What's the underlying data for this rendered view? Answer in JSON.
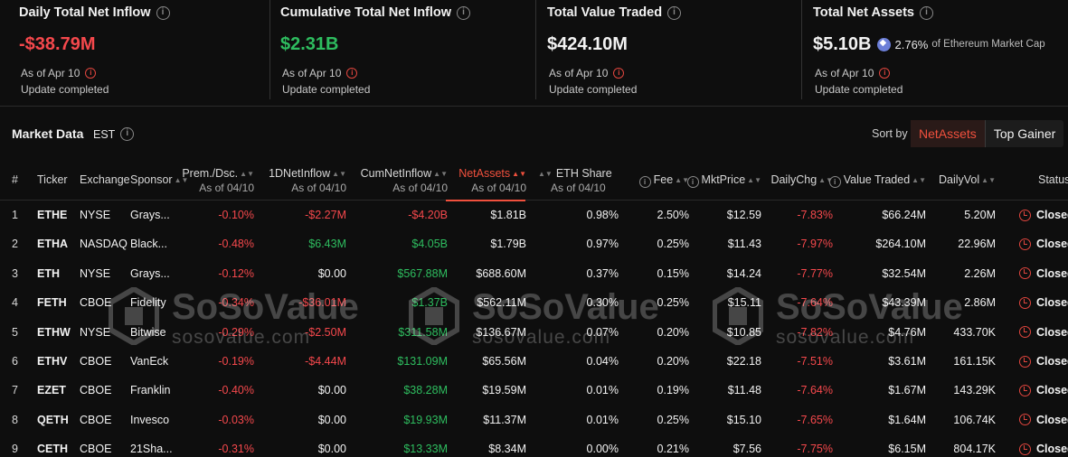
{
  "cards": [
    {
      "title": "Daily Total Net Inflow",
      "value": "-$38.79M",
      "as_of": "As of Apr 10",
      "status": "Update completed",
      "tone": "neg"
    },
    {
      "title": "Cumulative Total Net Inflow",
      "value": "$2.31B",
      "as_of": "As of Apr 10",
      "status": "Update completed",
      "tone": "pos"
    },
    {
      "title": "Total Value Traded",
      "value": "$424.10M",
      "as_of": "As of Apr 10",
      "status": "Update completed",
      "tone": "white"
    },
    {
      "title": "Total Net Assets",
      "value": "$5.10B",
      "eth_pct": "2.76%",
      "eth_suffix": "of Ethereum Market Cap",
      "as_of": "As of Apr 10",
      "status": "Update completed",
      "tone": "white"
    }
  ],
  "market": {
    "title": "Market Data",
    "timezone": "EST",
    "sort_label": "Sort by",
    "sort_options": [
      "NetAssets",
      "Top Gainer"
    ],
    "active_sort": "NetAssets"
  },
  "columns": {
    "no": "#",
    "ticker": "Ticker",
    "exchange": "Exchange",
    "sponsor": "Sponsor",
    "prem": "Prem./Dsc.",
    "prem_sub": "As of 04/10",
    "inflow1d": "1DNetInflow",
    "inflow1d_sub": "As of 04/10",
    "cuminflow": "CumNetInflow",
    "cuminflow_sub": "As of 04/10",
    "netassets": "NetAssets",
    "netassets_sub": "As of 04/10",
    "ethshare": "ETH Share",
    "ethshare_sub": "As of 04/10",
    "fee": "Fee",
    "mktprice": "MktPrice",
    "dailychg": "DailyChg",
    "valuetraded": "Value Traded",
    "dailyvol": "DailyVol",
    "status": "Status"
  },
  "rows": [
    {
      "no": "1",
      "ticker": "ETHE",
      "exchange": "NYSE",
      "sponsor": "Grays...",
      "prem": "-0.10%",
      "inflow1d": "-$2.27M",
      "cuminflow": "-$4.20B",
      "netassets": "$1.81B",
      "ethshare": "0.98%",
      "fee": "2.50%",
      "mktprice": "$12.59",
      "dailychg": "-7.83%",
      "valuetraded": "$66.24M",
      "dailyvol": "5.20M",
      "status": "Closed"
    },
    {
      "no": "2",
      "ticker": "ETHA",
      "exchange": "NASDAQ",
      "sponsor": "Black...",
      "prem": "-0.48%",
      "inflow1d": "$6.43M",
      "cuminflow": "$4.05B",
      "netassets": "$1.79B",
      "ethshare": "0.97%",
      "fee": "0.25%",
      "mktprice": "$11.43",
      "dailychg": "-7.97%",
      "valuetraded": "$264.10M",
      "dailyvol": "22.96M",
      "status": "Closed"
    },
    {
      "no": "3",
      "ticker": "ETH",
      "exchange": "NYSE",
      "sponsor": "Grays...",
      "prem": "-0.12%",
      "inflow1d": "$0.00",
      "cuminflow": "$567.88M",
      "netassets": "$688.60M",
      "ethshare": "0.37%",
      "fee": "0.15%",
      "mktprice": "$14.24",
      "dailychg": "-7.77%",
      "valuetraded": "$32.54M",
      "dailyvol": "2.26M",
      "status": "Closed"
    },
    {
      "no": "4",
      "ticker": "FETH",
      "exchange": "CBOE",
      "sponsor": "Fidelity",
      "prem": "-0.34%",
      "inflow1d": "-$36.01M",
      "cuminflow": "$1.37B",
      "netassets": "$562.11M",
      "ethshare": "0.30%",
      "fee": "0.25%",
      "mktprice": "$15.11",
      "dailychg": "-7.64%",
      "valuetraded": "$43.39M",
      "dailyvol": "2.86M",
      "status": "Closed"
    },
    {
      "no": "5",
      "ticker": "ETHW",
      "exchange": "NYSE",
      "sponsor": "Bitwise",
      "prem": "-0.29%",
      "inflow1d": "-$2.50M",
      "cuminflow": "$311.58M",
      "netassets": "$136.67M",
      "ethshare": "0.07%",
      "fee": "0.20%",
      "mktprice": "$10.85",
      "dailychg": "-7.82%",
      "valuetraded": "$4.76M",
      "dailyvol": "433.70K",
      "status": "Closed"
    },
    {
      "no": "6",
      "ticker": "ETHV",
      "exchange": "CBOE",
      "sponsor": "VanEck",
      "prem": "-0.19%",
      "inflow1d": "-$4.44M",
      "cuminflow": "$131.09M",
      "netassets": "$65.56M",
      "ethshare": "0.04%",
      "fee": "0.20%",
      "mktprice": "$22.18",
      "dailychg": "-7.51%",
      "valuetraded": "$3.61M",
      "dailyvol": "161.15K",
      "status": "Closed"
    },
    {
      "no": "7",
      "ticker": "EZET",
      "exchange": "CBOE",
      "sponsor": "Franklin",
      "prem": "-0.40%",
      "inflow1d": "$0.00",
      "cuminflow": "$38.28M",
      "netassets": "$19.59M",
      "ethshare": "0.01%",
      "fee": "0.19%",
      "mktprice": "$11.48",
      "dailychg": "-7.64%",
      "valuetraded": "$1.67M",
      "dailyvol": "143.29K",
      "status": "Closed"
    },
    {
      "no": "8",
      "ticker": "QETH",
      "exchange": "CBOE",
      "sponsor": "Invesco",
      "prem": "-0.03%",
      "inflow1d": "$0.00",
      "cuminflow": "$19.93M",
      "netassets": "$11.37M",
      "ethshare": "0.01%",
      "fee": "0.25%",
      "mktprice": "$15.10",
      "dailychg": "-7.65%",
      "valuetraded": "$1.64M",
      "dailyvol": "106.74K",
      "status": "Closed"
    },
    {
      "no": "9",
      "ticker": "CETH",
      "exchange": "CBOE",
      "sponsor": "21Sha...",
      "prem": "-0.31%",
      "inflow1d": "$0.00",
      "cuminflow": "$13.33M",
      "netassets": "$8.34M",
      "ethshare": "0.00%",
      "fee": "0.21%",
      "mktprice": "$7.56",
      "dailychg": "-7.75%",
      "valuetraded": "$6.15M",
      "dailyvol": "804.17K",
      "status": "Closed"
    }
  ],
  "watermark": {
    "big": "SoSoValue",
    "small": "sosovalue.com"
  },
  "colors": {
    "negative": "#f5484c",
    "positive": "#2ebd5f",
    "accent": "#f0503d",
    "background": "#0e0e0e"
  }
}
